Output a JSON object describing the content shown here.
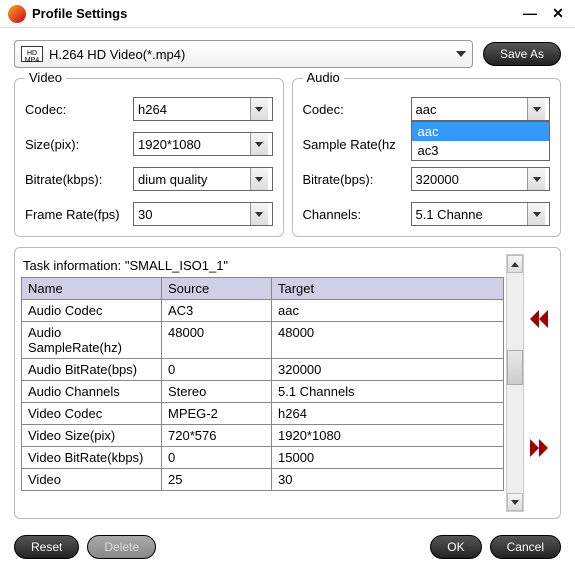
{
  "window": {
    "title": "Profile Settings"
  },
  "profile": {
    "text": "H.264 HD Video(*.mp4)",
    "icon_label": "HD\nMP4"
  },
  "buttons": {
    "save_as": "Save As",
    "reset": "Reset",
    "delete": "Delete",
    "ok": "OK",
    "cancel": "Cancel"
  },
  "video_panel": {
    "title": "Video",
    "codec_label": "Codec:",
    "codec_value": "h264",
    "size_label": "Size(pix):",
    "size_value": "1920*1080",
    "bitrate_label": "Bitrate(kbps):",
    "bitrate_value": "dium quality",
    "framerate_label": "Frame Rate(fps)",
    "framerate_value": "30"
  },
  "audio_panel": {
    "title": "Audio",
    "codec_label": "Codec:",
    "codec_value": "aac",
    "codec_options": {
      "opt1": "aac",
      "opt2": "ac3"
    },
    "samplerate_label": "Sample Rate(hz",
    "samplerate_value": "",
    "bitrate_label": "Bitrate(bps):",
    "bitrate_value": "320000",
    "channels_label": "Channels:",
    "channels_value": "5.1 Channe"
  },
  "task": {
    "caption": "Task information: \"SMALL_ISO1_1\"",
    "headers": {
      "name": "Name",
      "source": "Source",
      "target": "Target"
    },
    "rows": [
      {
        "name": "Audio Codec",
        "source": "AC3",
        "target": "aac"
      },
      {
        "name": "Audio SampleRate(hz)",
        "source": "48000",
        "target": "48000"
      },
      {
        "name": "Audio BitRate(bps)",
        "source": "0",
        "target": "320000"
      },
      {
        "name": "Audio Channels",
        "source": "Stereo",
        "target": "5.1 Channels"
      },
      {
        "name": "Video Codec",
        "source": "MPEG-2",
        "target": "h264"
      },
      {
        "name": "Video Size(pix)",
        "source": "720*576",
        "target": "1920*1080"
      },
      {
        "name": "Video BitRate(kbps)",
        "source": "0",
        "target": "15000"
      },
      {
        "name": "Video",
        "source": "25",
        "target": "30"
      }
    ]
  }
}
